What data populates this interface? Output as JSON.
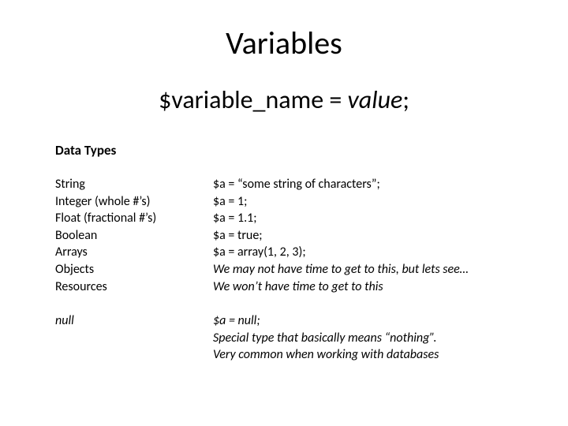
{
  "title": "Variables",
  "syntax": {
    "prefix": "$variable_name = ",
    "value_word": "value",
    "suffix": ";"
  },
  "subheading": "Data Types",
  "types": {
    "t0": "String",
    "t1": "Integer (whole #’s)",
    "t2": "Float (fractional #’s)",
    "t3": "Boolean",
    "t4": "Arrays",
    "t5": "Objects",
    "t6": "Resources",
    "t7": "null"
  },
  "examples": {
    "e0": "$a = “some string of characters”;",
    "e1": "$a = 1;",
    "e2": "$a = 1.1;",
    "e3": "$a = true;",
    "e4": "$a = array(1, 2, 3);",
    "e5": "We may not have time to get to this, but lets see…",
    "e6": "We won’t have time to get to this",
    "e7a": "$a = null;",
    "e7b": "Special type that basically means “nothing”.",
    "e7c": "Very common when working with databases"
  }
}
